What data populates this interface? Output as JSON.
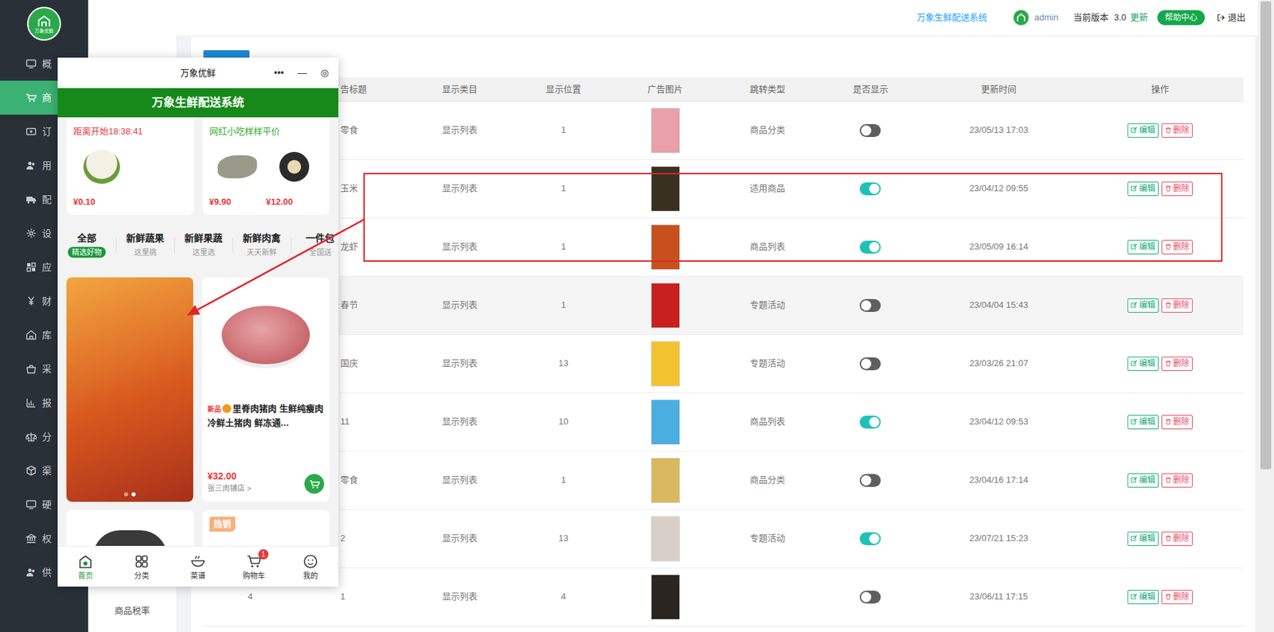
{
  "sidebar": {
    "logo": "万象优鲜",
    "items": [
      {
        "label": "概",
        "selected": false
      },
      {
        "label": "商",
        "selected": true
      },
      {
        "label": "订",
        "selected": false
      },
      {
        "label": "用",
        "selected": false
      },
      {
        "label": "配",
        "selected": false
      },
      {
        "label": "设",
        "selected": false
      },
      {
        "label": "应",
        "selected": false
      },
      {
        "label": "财",
        "selected": false
      },
      {
        "label": "库",
        "selected": false
      },
      {
        "label": "采",
        "selected": false
      },
      {
        "label": "报",
        "selected": false
      },
      {
        "label": "分",
        "selected": false
      },
      {
        "label": "渠",
        "selected": false
      },
      {
        "label": "硬",
        "selected": false
      },
      {
        "label": "权",
        "selected": false
      },
      {
        "label": "供",
        "selected": false
      }
    ]
  },
  "subnav": {
    "items": [
      "商品税率"
    ]
  },
  "header": {
    "system": "万象生鲜配送系统",
    "user": "admin",
    "version_label": "当前版本",
    "version": "3.0",
    "update": "更新",
    "help": "帮助中心",
    "logout": "退出"
  },
  "table": {
    "columns": [
      "",
      "告标题",
      "显示类目",
      "显示位置",
      "广告图片",
      "跳转类型",
      "是否显示",
      "更新时间",
      "操作"
    ],
    "rows": [
      {
        "cells": [
          "",
          "零食",
          "显示列表",
          "1"
        ],
        "jump": "商品分类",
        "shown": false,
        "updated": "23/05/13 17:03",
        "edit": "编辑",
        "delete": "删除",
        "boxed": false,
        "hovered": false
      },
      {
        "cells": [
          "",
          "玉米",
          "显示列表",
          "1"
        ],
        "jump": "适用商品",
        "shown": true,
        "updated": "23/04/12 09:55",
        "edit": "编辑",
        "delete": "删除",
        "boxed": true,
        "hovered": false
      },
      {
        "cells": [
          "",
          "龙虾",
          "显示列表",
          "1"
        ],
        "jump": "商品列表",
        "shown": true,
        "updated": "23/05/09 16:14",
        "edit": "编辑",
        "delete": "删除",
        "boxed": true,
        "hovered": false
      },
      {
        "cells": [
          "",
          "春节",
          "显示列表",
          "1"
        ],
        "jump": "专题活动",
        "shown": false,
        "updated": "23/04/04 15:43",
        "edit": "编辑",
        "delete": "删除",
        "boxed": false,
        "hovered": true
      },
      {
        "cells": [
          "",
          "国庆",
          "显示列表",
          "13"
        ],
        "jump": "专题活动",
        "shown": false,
        "updated": "23/03/26 21:07",
        "edit": "编辑",
        "delete": "删除",
        "boxed": false,
        "hovered": false
      },
      {
        "cells": [
          "",
          "11",
          "显示列表",
          "10"
        ],
        "jump": "商品列表",
        "shown": true,
        "updated": "23/04/12 09:53",
        "edit": "编辑",
        "delete": "删除",
        "boxed": false,
        "hovered": false
      },
      {
        "cells": [
          "",
          "零食",
          "显示列表",
          "1"
        ],
        "jump": "商品分类",
        "shown": false,
        "updated": "23/04/16 17:14",
        "edit": "编辑",
        "delete": "删除",
        "boxed": false,
        "hovered": false
      },
      {
        "cells": [
          "",
          "2",
          "显示列表",
          "13"
        ],
        "jump": "专题活动",
        "shown": true,
        "updated": "23/07/21 15:23",
        "edit": "编辑",
        "delete": "删除",
        "boxed": false,
        "hovered": false
      },
      {
        "cells": [
          "4",
          "1",
          "显示列表",
          "4"
        ],
        "jump": "",
        "shown": false,
        "updated": "23/06/11 17:15",
        "edit": "编辑",
        "delete": "删除",
        "boxed": false,
        "hovered": false
      }
    ]
  },
  "phone": {
    "title": "万象优鲜",
    "capsule": [
      "•••",
      "—",
      "◎"
    ],
    "header": "万象生鲜配送系统",
    "promos": [
      {
        "subtitle": "距离开始18:38:41",
        "color": "#e4393c",
        "prices": [
          "¥0.10"
        ]
      },
      {
        "subtitle": "网红小吃样样平价",
        "color": "#3aaa35",
        "prices": [
          "¥9.90",
          "¥12.00"
        ]
      }
    ],
    "categories": [
      {
        "label": "全部",
        "sub": "精选好物",
        "selected": true
      },
      {
        "label": "新鲜蔬果",
        "sub": "这里挑",
        "selected": false
      },
      {
        "label": "新鲜果蔬",
        "sub": "这里选",
        "selected": false
      },
      {
        "label": "新鲜肉禽",
        "sub": "天天新鲜",
        "selected": false
      },
      {
        "label": "一件包",
        "sub": "全国送",
        "selected": false
      }
    ],
    "banner_dots": [
      {
        "selected": false
      },
      {
        "selected": true
      }
    ],
    "product": {
      "tag": "新品",
      "title": "里脊肉猪肉 生鲜纯瘦肉 冷鲜土猪肉 鲜冻通…",
      "price": "¥32.00",
      "shop": "张三肉铺店 >"
    },
    "next_tag": "热销",
    "tabbar": [
      {
        "label": "首页",
        "selected": true,
        "badge": ""
      },
      {
        "label": "分类",
        "selected": false,
        "badge": ""
      },
      {
        "label": "菜谱",
        "selected": false,
        "badge": ""
      },
      {
        "label": "购物车",
        "selected": false,
        "badge": "1"
      },
      {
        "label": "我的",
        "selected": false,
        "badge": ""
      }
    ]
  }
}
